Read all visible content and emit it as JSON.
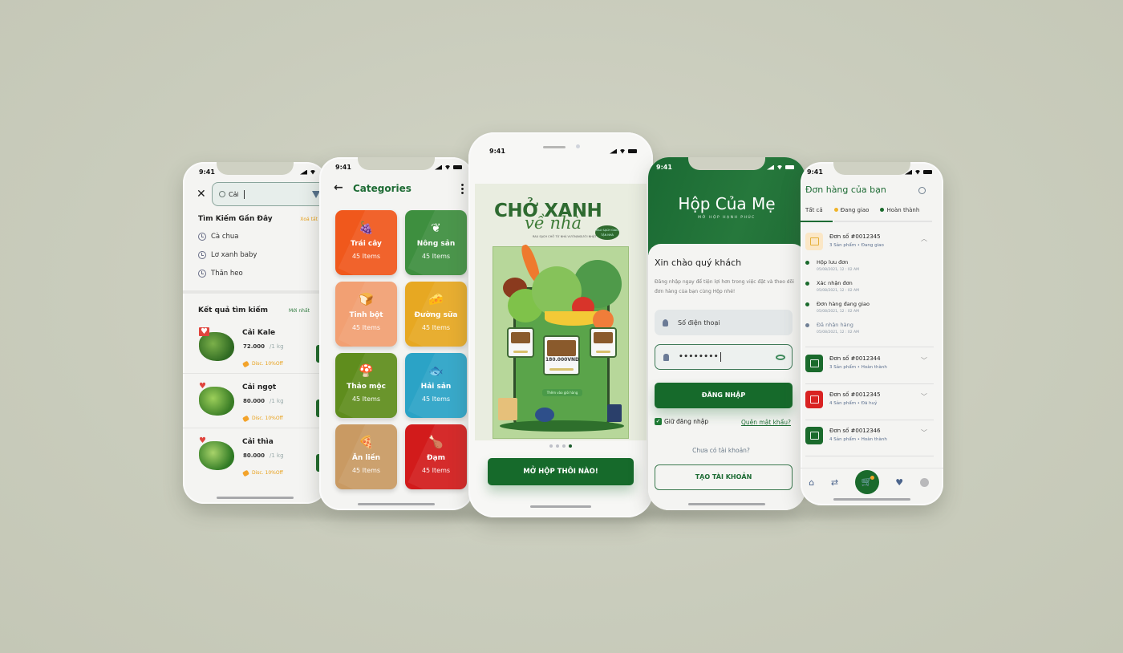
{
  "status_time": "9:41",
  "search_screen": {
    "query": "Cải",
    "recent_title": "Tìm Kiếm Gần Đây",
    "clear_all": "Xoá tất",
    "recent": [
      "Cà chua",
      "Lơ xanh baby",
      "Thăn heo"
    ],
    "results_title": "Kết quả tìm kiếm",
    "sort": "Mới nhất",
    "products": [
      {
        "name": "Cải Kale",
        "price": "72.000",
        "unit": "/1 kg",
        "discount": "Disc. 10%Off",
        "favorite": true
      },
      {
        "name": "Cải ngọt",
        "price": "80.000",
        "unit": "/1 kg",
        "discount": "Disc. 10%Off",
        "favorite": true
      },
      {
        "name": "Cải thìa",
        "price": "80.000",
        "unit": "/1 kg",
        "discount": "Disc. 10%Off",
        "favorite": true
      }
    ]
  },
  "categories_screen": {
    "title": "Categories",
    "items": [
      {
        "name": "Trái cây",
        "count": "45 Items",
        "color": "#f0581c",
        "icon": "🍇"
      },
      {
        "name": "Nông sản",
        "count": "45 Items",
        "color": "#3e8f3f",
        "icon": "❦"
      },
      {
        "name": "Tinh bột",
        "count": "45 Items",
        "color": "#f2a073",
        "icon": "🍞"
      },
      {
        "name": "Đường sữa",
        "count": "45 Items",
        "color": "#e7a822",
        "icon": "🧀"
      },
      {
        "name": "Thảo mộc",
        "count": "45 Items",
        "color": "#5f8d1d",
        "icon": "🍄"
      },
      {
        "name": "Hải sản",
        "count": "45 Items",
        "color": "#2ba3c6",
        "icon": "🐟"
      },
      {
        "name": "Ăn liền",
        "count": "45 Items",
        "color": "#c99a63",
        "icon": "🍕"
      },
      {
        "name": "Đạm",
        "count": "45 Items",
        "color": "#d21b1b",
        "icon": "🍗"
      }
    ]
  },
  "onboarding_screen": {
    "headline_1": "CHỞ XANH",
    "headline_2": "về nhà",
    "badge": "RAU SẠCH GIAO TẬN NHÀ",
    "tagline": "RAU SẠCH CHỞ TỪ NHÀ VƯỜN/NGƯỜI NHẬT",
    "price": "180.000VND",
    "small_cta": "Thêm vào giỏ hàng",
    "page_count": 4,
    "active_page": 4,
    "cta": "MỞ HỘP THÔI NÀO!"
  },
  "login_screen": {
    "brand": "Hộp Của Mẹ",
    "brand_sub": "MỞ HỘP HẠNH PHÚC",
    "greeting": "Xin chào quý khách",
    "intro": "Đăng nhập ngay để tiện lợi hơn trong việc đặt và theo dõi đơn hàng của bạn cùng Hộp nhé!",
    "phone_placeholder": "Số điện thoại",
    "password_value": "••••••••",
    "login_button": "ĐĂNG NHẬP",
    "remember": "Giữ đăng nhập",
    "remember_checked": true,
    "forgot": "Quên mật khẩu?",
    "no_account": "Chưa có tài khoản?",
    "create_button": "TẠO TÀI KHOẢN"
  },
  "orders_screen": {
    "title": "Đơn hàng của bạn",
    "tabs": [
      {
        "label": "Tất cả",
        "dot": null
      },
      {
        "label": "Đang giao",
        "dot": "#f0b429"
      },
      {
        "label": "Hoàn thành",
        "dot": "#1a6a2c"
      }
    ],
    "expanded_order": {
      "number": "Đơn số #0012345",
      "meta": "3 Sản phẩm • Đang giao",
      "steps": [
        {
          "label": "Hộp lưu đơn",
          "time": "05/08/2021, 12 : 02 AM",
          "done": true
        },
        {
          "label": "Xác nhận đơn",
          "time": "05/08/2021, 12 : 02 AM",
          "done": true
        },
        {
          "label": "Đơn hàng đang giao",
          "time": "05/08/2021, 12 : 02 AM",
          "done": true
        },
        {
          "label": "Đã nhận hàng",
          "time": "05/08/2021, 12 : 02 AM",
          "done": false
        }
      ]
    },
    "orders": [
      {
        "number": "Đơn số #0012344",
        "meta": "3 Sản phẩm • Hoàn thành",
        "color": "#1a6a2c"
      },
      {
        "number": "Đơn số #0012345",
        "meta": "4 Sản phẩm • Đã huỷ",
        "color": "#d92222"
      },
      {
        "number": "Đơn số #0012346",
        "meta": "4 Sản phẩm • Hoàn thành",
        "color": "#1a6a2c"
      }
    ],
    "nav": [
      "home",
      "exchange",
      "cart",
      "favorites",
      "profile"
    ]
  },
  "colors": {
    "brand_green": "#166a2b",
    "accent_orange": "#f0a52a",
    "background": "#cbcdbd"
  }
}
